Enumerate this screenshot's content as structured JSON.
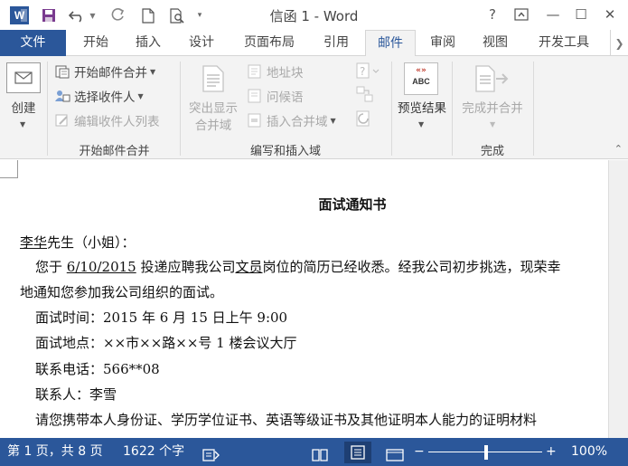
{
  "window": {
    "title": "信函 1 - Word",
    "help": "?",
    "minimize": "—",
    "maximize": "☐",
    "close": "✕"
  },
  "tabs": [
    "文件",
    "开始",
    "插入",
    "设计",
    "页面布局",
    "引用",
    "邮件",
    "审阅",
    "视图",
    "开发工具"
  ],
  "ribbon": {
    "create": {
      "label": "创建"
    },
    "start_group": {
      "start_merge": "开始邮件合并",
      "select_recipients": "选择收件人",
      "edit_list": "编辑收件人列表",
      "label": "开始邮件合并"
    },
    "write_group": {
      "highlight": "突出显示合并域",
      "highlight_line1": "突出显示",
      "highlight_line2": "合并域",
      "address_block": "地址块",
      "greeting_line": "问候语",
      "insert_field": "插入合并域",
      "label": "编写和插入域"
    },
    "preview": {
      "label": "预览结果",
      "icon_text": "ABC"
    },
    "finish": {
      "button": "完成并合并",
      "label": "完成"
    }
  },
  "document": {
    "title": "面试通知书",
    "salutation_name": "李华",
    "salutation_rest": "先生（小姐）：",
    "para1_pre": "您于 ",
    "para1_date": "6/10/2015",
    "para1_mid": " 投递应聘我公司",
    "para1_post": "文员",
    "para1_end": "岗位的简历已经收悉。经我公司初步挑选，现荣幸",
    "para1_line2": "地通知您参加我公司组织的面试。",
    "time": "面试时间：2015 年 6 月 15 日上午 9:00",
    "place": "面试地点：××市××路××号 1 楼会议大厅",
    "phone": "联系电话：566**08",
    "contact": "联系人：李雪",
    "last_line": "请您携带本人身份证、学历学位证书、英语等级证书及其他证明本人能力的证明材料"
  },
  "status": {
    "page": "第 1 页，共 8 页",
    "words": "1622 个字",
    "zoom": "100%",
    "zoom_minus": "−",
    "zoom_plus": "+"
  },
  "colors": {
    "accent": "#2b579a",
    "ribbon_bg": "#f3f3f3",
    "disabled_text": "#a8a8a8"
  }
}
